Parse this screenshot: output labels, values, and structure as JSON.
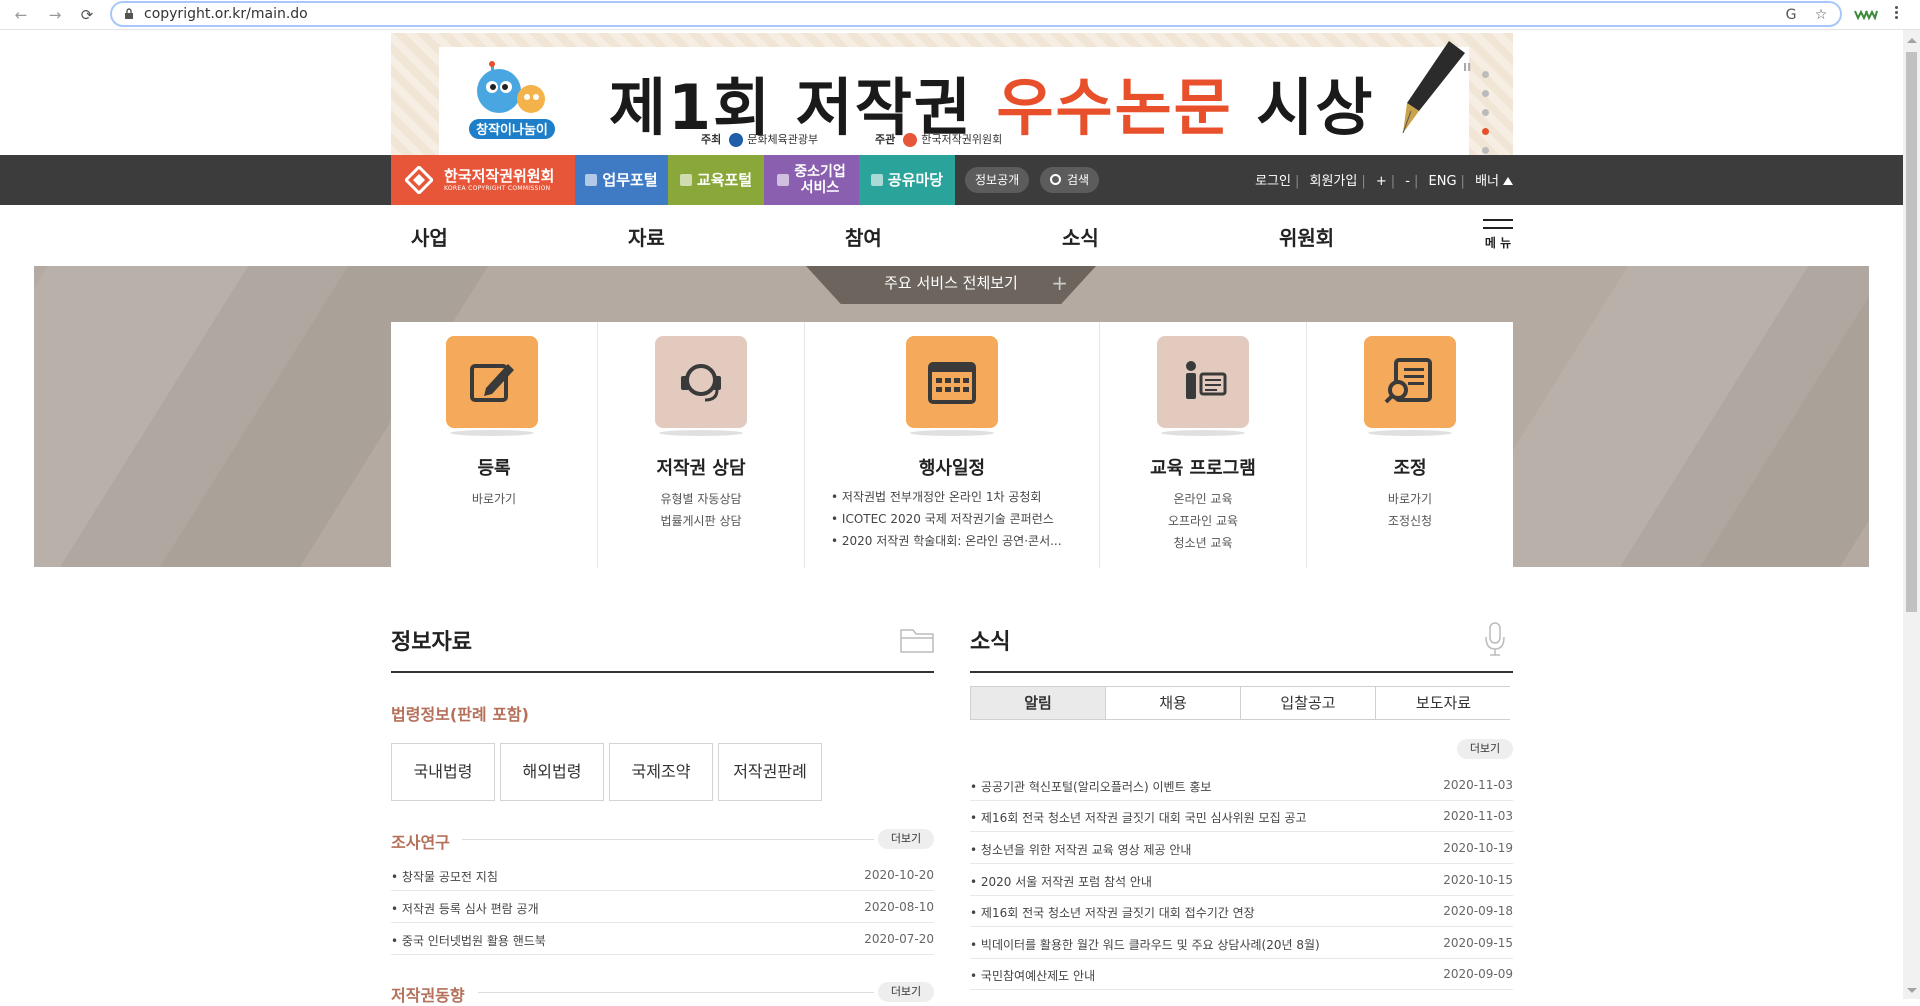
{
  "browser": {
    "url": "copyright.or.kr/main.do",
    "back": "←",
    "forward": "→",
    "reload": "⟳",
    "translate_icon": "G",
    "star_icon": "☆",
    "ext_icon": "ᵂᵂ"
  },
  "banner": {
    "title_part1": "제1회 저작권 ",
    "title_highlight": "우수논문",
    "title_part2": " 시상",
    "sponsor_label": "주최",
    "sponsor": "문화체육관광부",
    "organizer_label": "주관",
    "organizer": "한국저작권위원회",
    "pause": "II"
  },
  "utilbar": {
    "brand_name": "한국저작권위원회",
    "brand_sub": "KOREA COPYRIGHT COMMISSION",
    "portals": [
      {
        "label": "업무포털",
        "color": "#3f7bc4"
      },
      {
        "label": "교육포털",
        "color": "#8aa73a"
      },
      {
        "label": "중소기업\n서비스",
        "color": "#8a5fb0"
      },
      {
        "label": "공유마당",
        "color": "#2aa39a"
      }
    ],
    "info_open": "정보공개",
    "search": "검색",
    "links": [
      "로그인",
      "회원가입",
      "+",
      "-",
      "ENG",
      "배너"
    ]
  },
  "gnb": {
    "items": [
      "사업",
      "자료",
      "참여",
      "소식",
      "위원회"
    ],
    "menu_label": "메 뉴"
  },
  "services": {
    "tab_label": "주요 서비스 전체보기",
    "tab_plus": "+",
    "cards": [
      {
        "title": "등록",
        "links": [
          "바로가기"
        ]
      },
      {
        "title": "저작권 상담",
        "links": [
          "유형별 자동상담",
          "법률게시판 상담"
        ]
      },
      {
        "title": "행사일정",
        "events": [
          "저작권법 전부개정안 온라인 1차 공청회",
          "ICOTEC 2020 국제 저작권기술 콘퍼런스",
          "2020 저작권 학술대회: 온라인 공연·콘서..."
        ]
      },
      {
        "title": "교육 프로그램",
        "links": [
          "온라인 교육",
          "오프라인 교육",
          "청소년 교육"
        ]
      },
      {
        "title": "조정",
        "links": [
          "바로가기",
          "조정신청"
        ]
      }
    ]
  },
  "info": {
    "title": "정보자료",
    "law_title": "법령정보(판례 포함)",
    "law_buttons": [
      "국내법령",
      "해외법령",
      "국제조약",
      "저작권판례"
    ],
    "research_title": "조사연구",
    "research_more": "더보기",
    "research_rows": [
      {
        "title": "창작물 공모전 지침",
        "date": "2020-10-20"
      },
      {
        "title": "저작권 등록 심사 편람 공개",
        "date": "2020-08-10"
      },
      {
        "title": "중국 인터넷법원 활용 핸드북",
        "date": "2020-07-20"
      }
    ],
    "trend_title": "저작권동향",
    "trend_more": "더보기"
  },
  "news": {
    "title": "소식",
    "tabs": [
      "알림",
      "채용",
      "입찰공고",
      "보도자료"
    ],
    "more": "더보기",
    "rows": [
      {
        "title": "공공기관 혁신포털(알리오플러스) 이벤트 홍보",
        "date": "2020-11-03"
      },
      {
        "title": "제16회 전국 청소년 저작권 글짓기 대회 국민 심사위원 모집 공고",
        "date": "2020-11-03"
      },
      {
        "title": "청소년을 위한 저작권 교육 영상 제공 안내",
        "date": "2020-10-19"
      },
      {
        "title": "2020 서울 저작권 포럼 참석 안내",
        "date": "2020-10-15"
      },
      {
        "title": "제16회 전국 청소년 저작권 글짓기 대회 접수기간 연장",
        "date": "2020-09-18"
      },
      {
        "title": "빅데이터를 활용한 월간 워드 클라우드 및 주요 상담사례(20년 8월)",
        "date": "2020-09-15"
      },
      {
        "title": "국민참여예산제도 안내",
        "date": "2020-09-09"
      }
    ]
  }
}
